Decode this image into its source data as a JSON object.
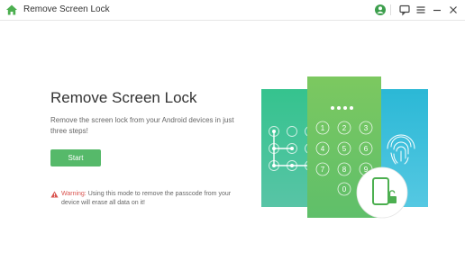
{
  "window": {
    "title": "Remove Screen Lock",
    "icons": [
      "home-icon",
      "account-icon",
      "feedback-icon",
      "menu-icon",
      "minimize-icon",
      "close-icon"
    ]
  },
  "main": {
    "title": "Remove Screen Lock",
    "description": "Remove the screen lock from your Android devices in just three steps!",
    "start_label": "Start",
    "warning_label": "Warning:",
    "warning_text": " Using this mode to remove the passcode from your device will erase all data on it!"
  },
  "illustration": {
    "pin_keys": [
      "1",
      "2",
      "3",
      "4",
      "5",
      "6",
      "7",
      "8",
      "9",
      "0"
    ]
  },
  "colors": {
    "accent": "#56b96a",
    "warning": "#d9534f",
    "pattern_panel": "#3fc09a",
    "pin_panel": "#76c564",
    "fingerprint_panel": "#31b9d6"
  }
}
